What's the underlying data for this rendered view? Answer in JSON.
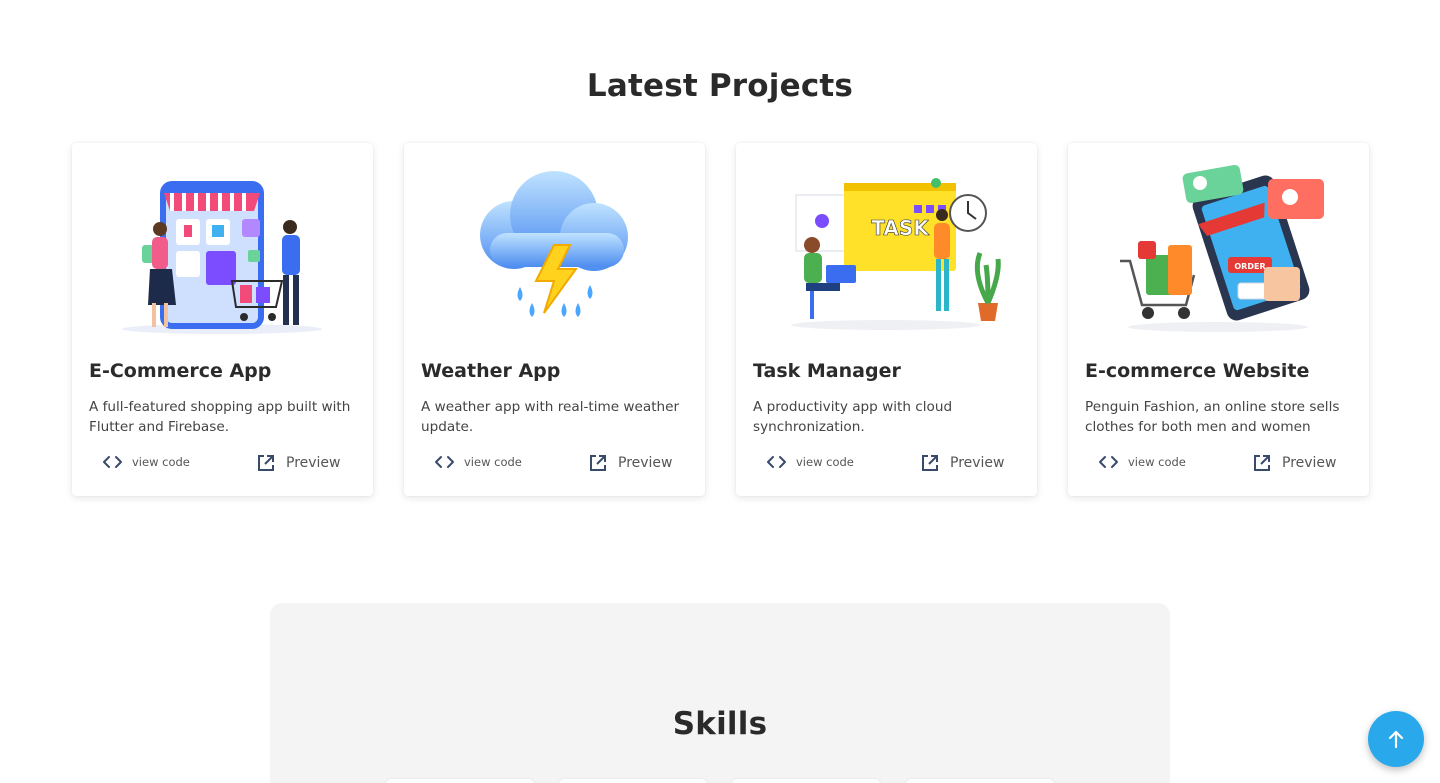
{
  "projects": {
    "title": "Latest Projects",
    "cards": [
      {
        "title": "E-Commerce App",
        "description": "A full-featured shopping app built with Flutter and Firebase.",
        "code_label": "view code",
        "preview_label": "Preview",
        "illustration": "shopping-app-illustration"
      },
      {
        "title": "Weather App",
        "description": "A weather app with real-time weather update.",
        "code_label": "view code",
        "preview_label": "Preview",
        "illustration": "storm-cloud-illustration"
      },
      {
        "title": "Task Manager",
        "description": "A productivity app with cloud synchronization.",
        "code_label": "view code",
        "preview_label": "Preview",
        "illustration": "task-management-illustration",
        "illustration_text": "TASK"
      },
      {
        "title": "E-commerce Website",
        "description": "Penguin Fashion, an online store sells clothes for both men and women",
        "code_label": "view code",
        "preview_label": "Preview",
        "illustration": "online-store-illustration",
        "illustration_text": "ORDER"
      }
    ]
  },
  "skills": {
    "title": "Skills"
  },
  "scroll_top": {
    "icon": "arrow-up-icon"
  },
  "colors": {
    "accent": "#29a8ec",
    "panel": "#f4f4f4"
  }
}
